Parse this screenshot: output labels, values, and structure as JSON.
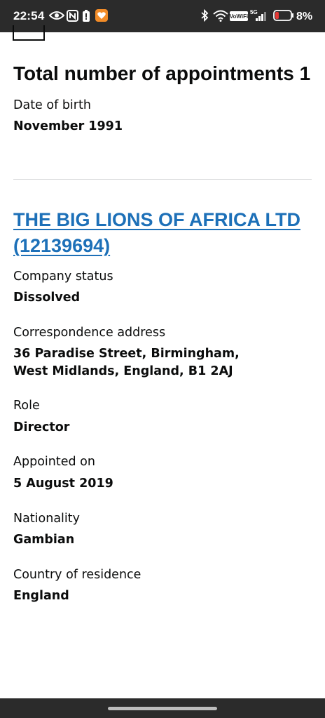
{
  "status_bar": {
    "time": "22:54",
    "vowifi": "VoWiFi",
    "network": "5G",
    "battery_percent": "8%",
    "battery_level": 0.08,
    "icons": [
      "eye-icon",
      "nfc-icon",
      "battery-saver-icon",
      "heart-app-icon",
      "bluetooth-icon",
      "wifi-icon",
      "signal-icon",
      "battery-icon"
    ]
  },
  "page": {
    "title": "Total number of appointments 1",
    "dob_label": "Date of birth",
    "dob_value": "November 1991"
  },
  "appointment": {
    "company_link": "THE BIG LIONS OF AFRICA LTD (12139694)",
    "status_label": "Company status",
    "status_value": "Dissolved",
    "address_label": "Correspondence address",
    "address_value": "36 Paradise Street, Birmingham, West Midlands, England, B1 2AJ",
    "role_label": "Role",
    "role_value": "Director",
    "appointed_label": "Appointed on",
    "appointed_value": "5 August 2019",
    "nationality_label": "Nationality",
    "nationality_value": "Gambian",
    "residence_label": "Country of residence",
    "residence_value": "England"
  },
  "colors": {
    "link": "#1d70b8",
    "text": "#0b0c0c",
    "status_bar_bg": "#2b2b2b",
    "divider": "#d8dadb"
  }
}
